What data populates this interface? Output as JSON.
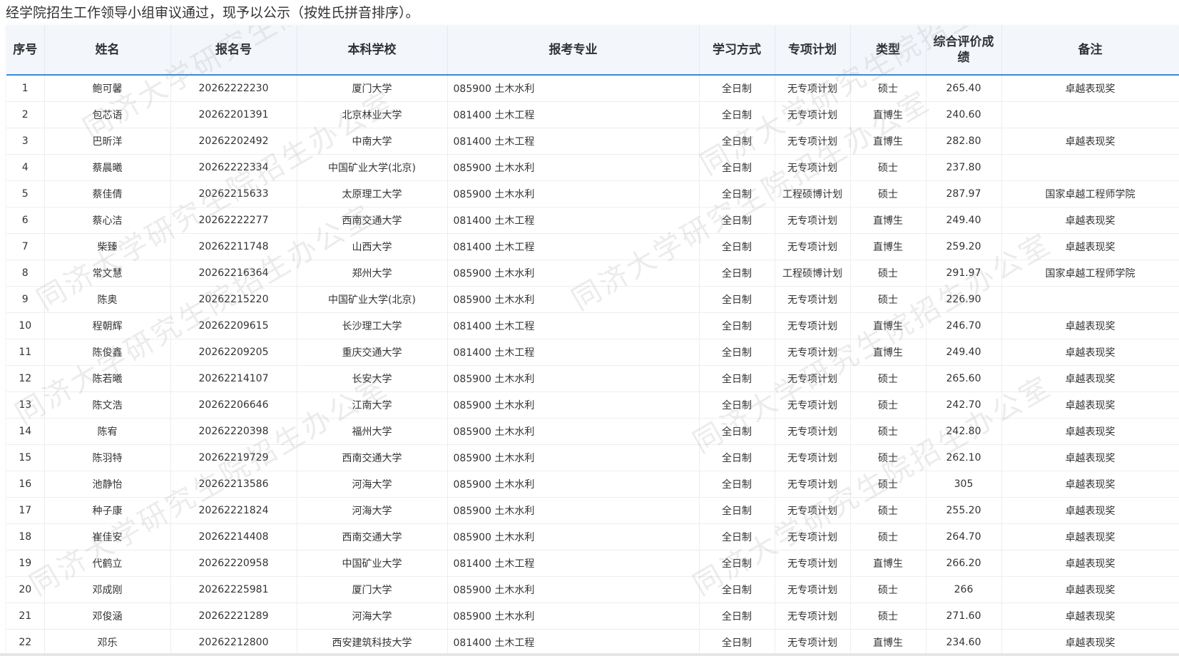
{
  "notice": "经学院招生工作领导小组审议通过，现予以公示（按姓氏拼音排序）。",
  "watermark_text": "同济大学研究生院招生办公室",
  "colors": {
    "header_bg": "#f3f7fc",
    "header_border": "#2f8be8",
    "grid": "#ebeef3"
  },
  "columns": [
    "序号",
    "姓名",
    "报名号",
    "本科学校",
    "报考专业",
    "学习方式",
    "专项计划",
    "类型",
    "综合评价成绩",
    "备注"
  ],
  "rows": [
    [
      "1",
      "鲍可馨",
      "20262222230",
      "厦门大学",
      "085900 土木水利",
      "全日制",
      "无专项计划",
      "硕士",
      "265.40",
      "卓越表现奖"
    ],
    [
      "2",
      "包芯语",
      "20262201391",
      "北京林业大学",
      "081400 土木工程",
      "全日制",
      "无专项计划",
      "直博生",
      "240.60",
      ""
    ],
    [
      "3",
      "巴昕洋",
      "20262202492",
      "中南大学",
      "081400 土木工程",
      "全日制",
      "无专项计划",
      "直博生",
      "282.80",
      "卓越表现奖"
    ],
    [
      "4",
      "蔡晨曦",
      "20262222334",
      "中国矿业大学(北京)",
      "085900 土木水利",
      "全日制",
      "无专项计划",
      "硕士",
      "237.80",
      ""
    ],
    [
      "5",
      "蔡佳倩",
      "20262215633",
      "太原理工大学",
      "085900 土木水利",
      "全日制",
      "工程硕博计划",
      "硕士",
      "287.97",
      "国家卓越工程师学院"
    ],
    [
      "6",
      "蔡心洁",
      "20262222277",
      "西南交通大学",
      "081400 土木工程",
      "全日制",
      "无专项计划",
      "直博生",
      "249.40",
      "卓越表现奖"
    ],
    [
      "7",
      "柴臻",
      "20262211748",
      "山西大学",
      "081400 土木工程",
      "全日制",
      "无专项计划",
      "直博生",
      "259.20",
      "卓越表现奖"
    ],
    [
      "8",
      "常文慧",
      "20262216364",
      "郑州大学",
      "085900 土木水利",
      "全日制",
      "工程硕博计划",
      "硕士",
      "291.97",
      "国家卓越工程师学院"
    ],
    [
      "9",
      "陈奥",
      "20262215220",
      "中国矿业大学(北京)",
      "085900 土木水利",
      "全日制",
      "无专项计划",
      "硕士",
      "226.90",
      ""
    ],
    [
      "10",
      "程朝辉",
      "20262209615",
      "长沙理工大学",
      "081400 土木工程",
      "全日制",
      "无专项计划",
      "直博生",
      "246.70",
      "卓越表现奖"
    ],
    [
      "11",
      "陈俊鑫",
      "20262209205",
      "重庆交通大学",
      "081400 土木工程",
      "全日制",
      "无专项计划",
      "直博生",
      "249.40",
      "卓越表现奖"
    ],
    [
      "12",
      "陈若曦",
      "20262214107",
      "长安大学",
      "085900 土木水利",
      "全日制",
      "无专项计划",
      "硕士",
      "265.60",
      "卓越表现奖"
    ],
    [
      "13",
      "陈文浩",
      "20262206646",
      "江南大学",
      "085900 土木水利",
      "全日制",
      "无专项计划",
      "硕士",
      "242.70",
      "卓越表现奖"
    ],
    [
      "14",
      "陈宥",
      "20262220398",
      "福州大学",
      "085900 土木水利",
      "全日制",
      "无专项计划",
      "硕士",
      "242.80",
      "卓越表现奖"
    ],
    [
      "15",
      "陈羽特",
      "20262219729",
      "西南交通大学",
      "085900 土木水利",
      "全日制",
      "无专项计划",
      "硕士",
      "262.10",
      "卓越表现奖"
    ],
    [
      "16",
      "池静怡",
      "20262213586",
      "河海大学",
      "085900 土木水利",
      "全日制",
      "无专项计划",
      "硕士",
      "305",
      "卓越表现奖"
    ],
    [
      "17",
      "种子康",
      "20262221824",
      "河海大学",
      "085900 土木水利",
      "全日制",
      "无专项计划",
      "硕士",
      "255.20",
      "卓越表现奖"
    ],
    [
      "18",
      "崔佳安",
      "20262214408",
      "西南交通大学",
      "085900 土木水利",
      "全日制",
      "无专项计划",
      "硕士",
      "264.70",
      "卓越表现奖"
    ],
    [
      "19",
      "代鹤立",
      "20262220958",
      "中国矿业大学",
      "081400 土木工程",
      "全日制",
      "无专项计划",
      "直博生",
      "266.20",
      "卓越表现奖"
    ],
    [
      "20",
      "邓成刚",
      "20262225981",
      "厦门大学",
      "085900 土木水利",
      "全日制",
      "无专项计划",
      "硕士",
      "266",
      "卓越表现奖"
    ],
    [
      "21",
      "邓俊涵",
      "20262221289",
      "河海大学",
      "085900 土木水利",
      "全日制",
      "无专项计划",
      "硕士",
      "271.60",
      "卓越表现奖"
    ],
    [
      "22",
      "邓乐",
      "20262212800",
      "西安建筑科技大学",
      "081400 土木工程",
      "全日制",
      "无专项计划",
      "直博生",
      "234.60",
      "卓越表现奖"
    ]
  ]
}
